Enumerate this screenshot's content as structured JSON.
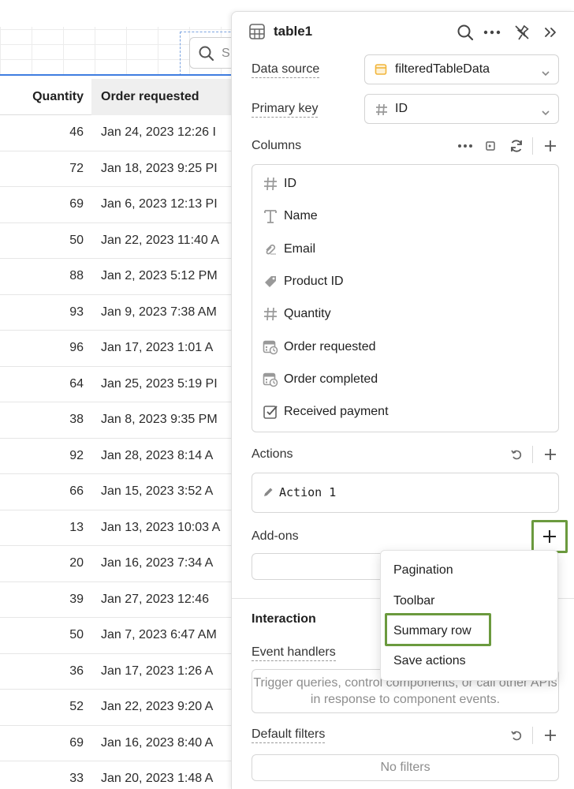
{
  "table": {
    "search_placeholder": "S",
    "headers": {
      "quantity": "Quantity",
      "order_requested": "Order requested"
    },
    "rows": [
      {
        "quantity": "46",
        "order": "Jan 24, 2023 12:26 I"
      },
      {
        "quantity": "72",
        "order": "Jan 18, 2023 9:25 PI"
      },
      {
        "quantity": "69",
        "order": "Jan 6, 2023 12:13 PI"
      },
      {
        "quantity": "50",
        "order": "Jan 22, 2023 11:40 A"
      },
      {
        "quantity": "88",
        "order": "Jan 2, 2023 5:12 PM"
      },
      {
        "quantity": "93",
        "order": "Jan 9, 2023 7:38 AM"
      },
      {
        "quantity": "96",
        "order": "Jan 17, 2023 1:01 A"
      },
      {
        "quantity": "64",
        "order": "Jan 25, 2023 5:19 PI"
      },
      {
        "quantity": "38",
        "order": "Jan 8, 2023 9:35 PM"
      },
      {
        "quantity": "92",
        "order": "Jan 28, 2023 8:14 A"
      },
      {
        "quantity": "66",
        "order": "Jan 15, 2023 3:52 A"
      },
      {
        "quantity": "13",
        "order": "Jan 13, 2023 10:03 A"
      },
      {
        "quantity": "20",
        "order": "Jan 16, 2023 7:34 A"
      },
      {
        "quantity": "39",
        "order": "Jan 27, 2023 12:46"
      },
      {
        "quantity": "50",
        "order": "Jan 7, 2023 6:47 AM"
      },
      {
        "quantity": "36",
        "order": "Jan 17, 2023 1:26 A"
      },
      {
        "quantity": "52",
        "order": "Jan 22, 2023 9:20 A"
      },
      {
        "quantity": "69",
        "order": "Jan 16, 2023 8:40 A"
      },
      {
        "quantity": "33",
        "order": "Jan 20, 2023 1:48 A"
      }
    ]
  },
  "panel": {
    "title": "table1",
    "data_source": {
      "label": "Data source",
      "value": "filteredTableData"
    },
    "primary_key": {
      "label": "Primary key",
      "value": "ID"
    },
    "columns": {
      "title": "Columns",
      "items": [
        {
          "icon": "hash-icon",
          "label": "ID"
        },
        {
          "icon": "text-icon",
          "label": "Name"
        },
        {
          "icon": "email-icon",
          "label": "Email"
        },
        {
          "icon": "tag-icon",
          "label": "Product ID"
        },
        {
          "icon": "hash-icon",
          "label": "Quantity"
        },
        {
          "icon": "calendar-clock-icon",
          "label": "Order requested"
        },
        {
          "icon": "calendar-clock-icon",
          "label": "Order completed"
        },
        {
          "icon": "checkbox-icon",
          "label": "Received payment"
        }
      ]
    },
    "actions": {
      "title": "Actions",
      "items": [
        "Action 1"
      ]
    },
    "addons": {
      "title": "Add-ons"
    },
    "interaction": {
      "title": "Interaction"
    },
    "event_handlers": {
      "label": "Event handlers",
      "placeholder": "Trigger queries, control components, or call other APIs in response to component events."
    },
    "default_filters": {
      "label": "Default filters",
      "empty": "No filters"
    }
  },
  "dropdown": {
    "items": [
      "Pagination",
      "Toolbar",
      "Summary row",
      "Save actions"
    ],
    "highlighted": "Summary row"
  },
  "colors": {
    "accent_blue": "#3f7de0",
    "highlight_green": "#6b9a3e",
    "data_source_icon": "#f2b63c"
  }
}
